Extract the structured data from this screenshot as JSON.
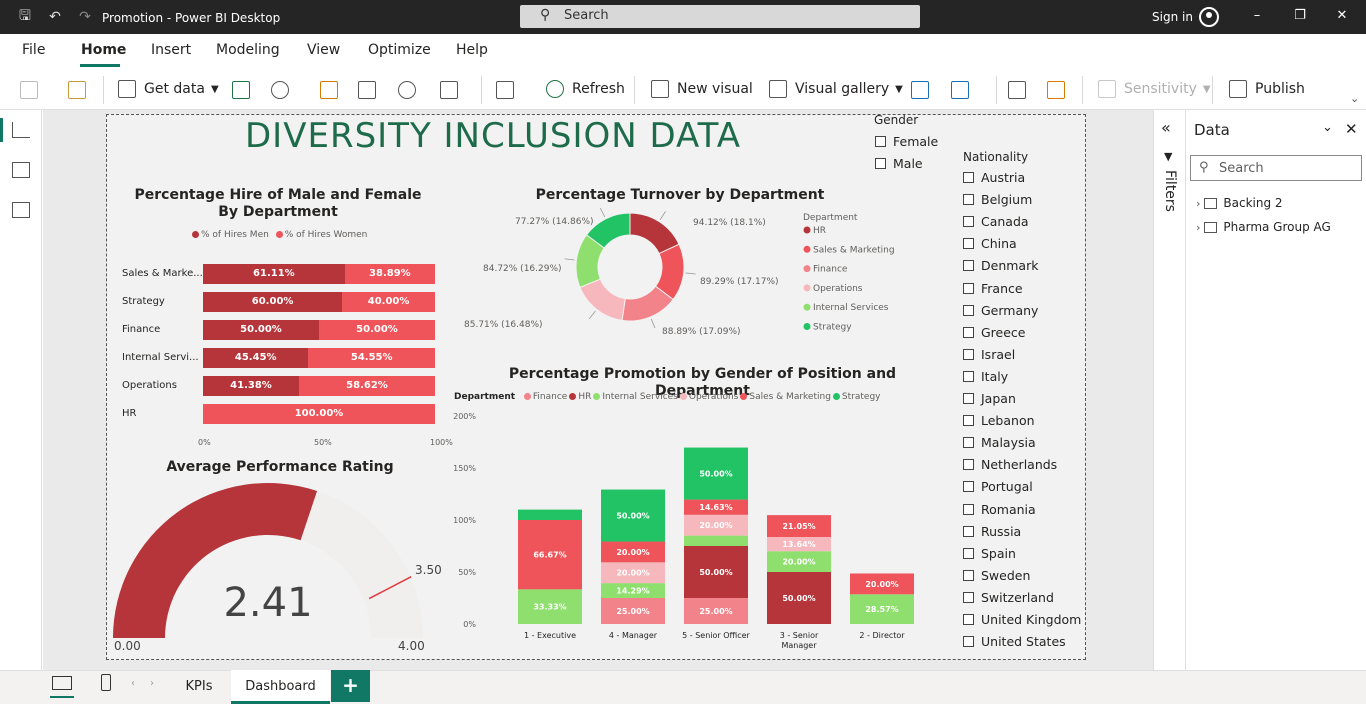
{
  "window": {
    "title": "Promotion - Power BI Desktop",
    "search_placeholder": "Search",
    "sign_in": "Sign in"
  },
  "menu": [
    "File",
    "Home",
    "Insert",
    "Modeling",
    "View",
    "Optimize",
    "Help"
  ],
  "menu_active": "Home",
  "ribbon": {
    "get_data": "Get data",
    "refresh": "Refresh",
    "new_visual": "New visual",
    "visual_gallery": "Visual gallery",
    "sensitivity": "Sensitivity",
    "publish": "Publish"
  },
  "report": {
    "title": "DIVERSITY INCLUSION DATA",
    "gender_slicer": {
      "title": "Gender",
      "items": [
        "Female",
        "Male"
      ]
    },
    "nationality_slicer": {
      "title": "Nationality",
      "items": [
        "Austria",
        "Belgium",
        "Canada",
        "China",
        "Denmark",
        "France",
        "Germany",
        "Greece",
        "Israel",
        "Italy",
        "Japan",
        "Lebanon",
        "Malaysia",
        "Netherlands",
        "Portugal",
        "Romania",
        "Russia",
        "Spain",
        "Sweden",
        "Switzerland",
        "United Kingdom",
        "United States"
      ]
    }
  },
  "colors": {
    "dark_red": "#b5353b",
    "red": "#ee5459",
    "pink": "#f3838a",
    "light_pink": "#f6b8bd",
    "light_green": "#8fdf6e",
    "green": "#21c364",
    "brand_green": "#117865",
    "title_green": "#1e6b4b"
  },
  "chart_data": [
    {
      "type": "bar",
      "orientation": "horizontal-stacked-100",
      "title": "Percentage Hire of Male and Female By Department",
      "categories": [
        "Sales & Marke...",
        "Strategy",
        "Finance",
        "Internal Servi...",
        "Operations",
        "HR"
      ],
      "series": [
        {
          "name": "% of Hires Men",
          "values": [
            61.11,
            60.0,
            50.0,
            45.45,
            41.38,
            0
          ],
          "color": "#b5353b"
        },
        {
          "name": "% of Hires Women",
          "values": [
            38.89,
            40.0,
            50.0,
            54.55,
            58.62,
            100.0
          ],
          "color": "#ee5459"
        }
      ],
      "value_labels": [
        [
          "61.11%",
          "38.89%"
        ],
        [
          "60.00%",
          "40.00%"
        ],
        [
          "50.00%",
          "50.00%"
        ],
        [
          "45.45%",
          "54.55%"
        ],
        [
          "41.38%",
          "58.62%"
        ],
        [
          "",
          "100.00%"
        ]
      ],
      "xticks": [
        "0%",
        "50%",
        "100%"
      ],
      "xlim": [
        0,
        100
      ],
      "legend": "top"
    },
    {
      "type": "pie",
      "variant": "donut",
      "title": "Percentage Turnover by Department",
      "legend_title": "Department",
      "slices": [
        {
          "name": "HR",
          "value": 94.12,
          "share": 18.1,
          "label": "94.12% (18.1%)",
          "color": "#b5353b"
        },
        {
          "name": "Sales & Marketing",
          "value": 89.29,
          "share": 17.17,
          "label": "89.29% (17.17%)",
          "color": "#ee5459"
        },
        {
          "name": "Finance",
          "value": 88.89,
          "share": 17.09,
          "label": "88.89% (17.09%)",
          "color": "#f3838a"
        },
        {
          "name": "Operations",
          "value": 85.71,
          "share": 16.48,
          "label": "85.71% (16.48%)",
          "color": "#f6b8bd"
        },
        {
          "name": "Internal Services",
          "value": 84.72,
          "share": 16.29,
          "label": "84.72% (16.29%)",
          "color": "#8fdf6e"
        },
        {
          "name": "Strategy",
          "value": 77.27,
          "share": 14.86,
          "label": "77.27% (14.86%)",
          "color": "#21c364"
        }
      ],
      "legend": "right"
    },
    {
      "type": "bar",
      "orientation": "vertical-stacked",
      "title": "Percentage Promotion by Gender of Position and Department",
      "legend_title": "Department",
      "legend_order": [
        "Finance",
        "HR",
        "Internal Services",
        "Operations",
        "Sales & Marketing",
        "Strategy"
      ],
      "categories": [
        "1 - Executive",
        "4 - Manager",
        "5 - Senior Officer",
        "3 - Senior Manager",
        "2 - Director"
      ],
      "series": [
        {
          "name": "Finance",
          "color": "#f3838a",
          "values": [
            0,
            25.0,
            25.0,
            0,
            0
          ]
        },
        {
          "name": "HR",
          "color": "#b5353b",
          "values": [
            0,
            0,
            50.0,
            50.0,
            0
          ]
        },
        {
          "name": "Internal Services",
          "color": "#8fdf6e",
          "values": [
            33.33,
            14.29,
            10.0,
            20.0,
            28.57
          ]
        },
        {
          "name": "Operations",
          "color": "#f6b8bd",
          "values": [
            0,
            20.0,
            20.0,
            13.64,
            0
          ]
        },
        {
          "name": "Sales & Marketing",
          "color": "#ee5459",
          "values": [
            66.67,
            20.0,
            14.63,
            21.05,
            20.0
          ]
        },
        {
          "name": "Strategy",
          "color": "#21c364",
          "values": [
            10.0,
            50.0,
            50.0,
            0,
            0
          ]
        }
      ],
      "value_labels": {
        "Finance": [
          "",
          "25.00%",
          "25.00%",
          "",
          ""
        ],
        "HR": [
          "",
          "",
          "50.00%",
          "50.00%",
          ""
        ],
        "Internal Services": [
          "33.33%",
          "14.29%",
          "",
          "20.00%",
          "28.57%"
        ],
        "Operations": [
          "",
          "20.00%",
          "20.00%",
          "13.64%",
          ""
        ],
        "Sales & Marketing": [
          "66.67%",
          "20.00%",
          "14.63%",
          "21.05%",
          "20.00%"
        ],
        "Strategy": [
          "",
          "50.00%",
          "50.00%",
          "",
          ""
        ]
      },
      "ylim": [
        0,
        200
      ],
      "yticks": [
        "0%",
        "50%",
        "100%",
        "150%",
        "200%"
      ],
      "legend": "top"
    },
    {
      "type": "gauge",
      "title": "Average Performance Rating",
      "value": 2.41,
      "value_label": "2.41",
      "min": 0,
      "max": 4,
      "min_label": "0.00",
      "max_label": "4.00",
      "target": 3.5,
      "target_label": "3.50",
      "fill_color": "#b5353b",
      "target_color": "#e0393e"
    }
  ],
  "data_pane": {
    "title": "Data",
    "search_placeholder": "Search",
    "tables": [
      "Backing 2",
      "Pharma Group AG"
    ],
    "filters_label": "Filters"
  },
  "tabs": {
    "items": [
      "KPIs",
      "Dashboard"
    ],
    "active": "Dashboard",
    "add": "+"
  }
}
